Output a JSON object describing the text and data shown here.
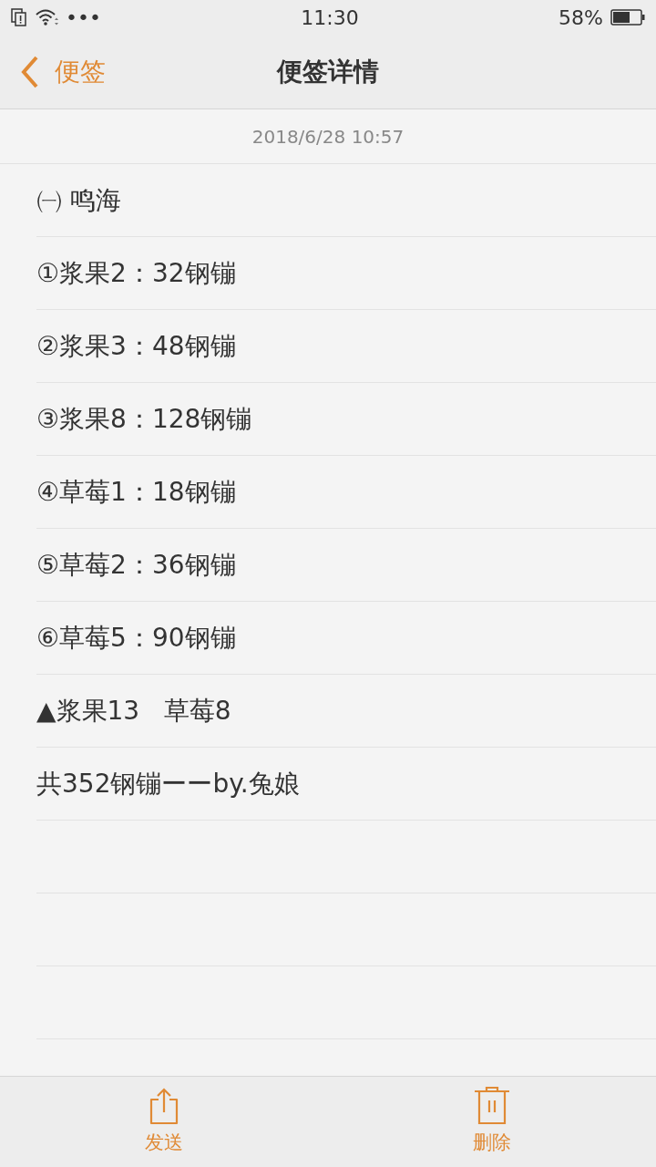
{
  "status_bar": {
    "time": "11:30",
    "more": "•••",
    "battery": "58%"
  },
  "nav": {
    "back": "便签",
    "title": "便签详情"
  },
  "date": "2018/6/28 10:57",
  "lines": [
    "㈠ 鸣海",
    "①浆果2：32钢镚",
    "②浆果3：48钢镚",
    "③浆果8：128钢镚",
    "④草莓1：18钢镚",
    "⑤草莓2：36钢镚",
    "⑥草莓5：90钢镚",
    "▲浆果13   草莓8",
    "共352钢镚ーーby.兔娘"
  ],
  "toolbar": [
    {
      "kind": "share",
      "label": "发送"
    },
    {
      "kind": "delete",
      "label": "删除"
    }
  ]
}
